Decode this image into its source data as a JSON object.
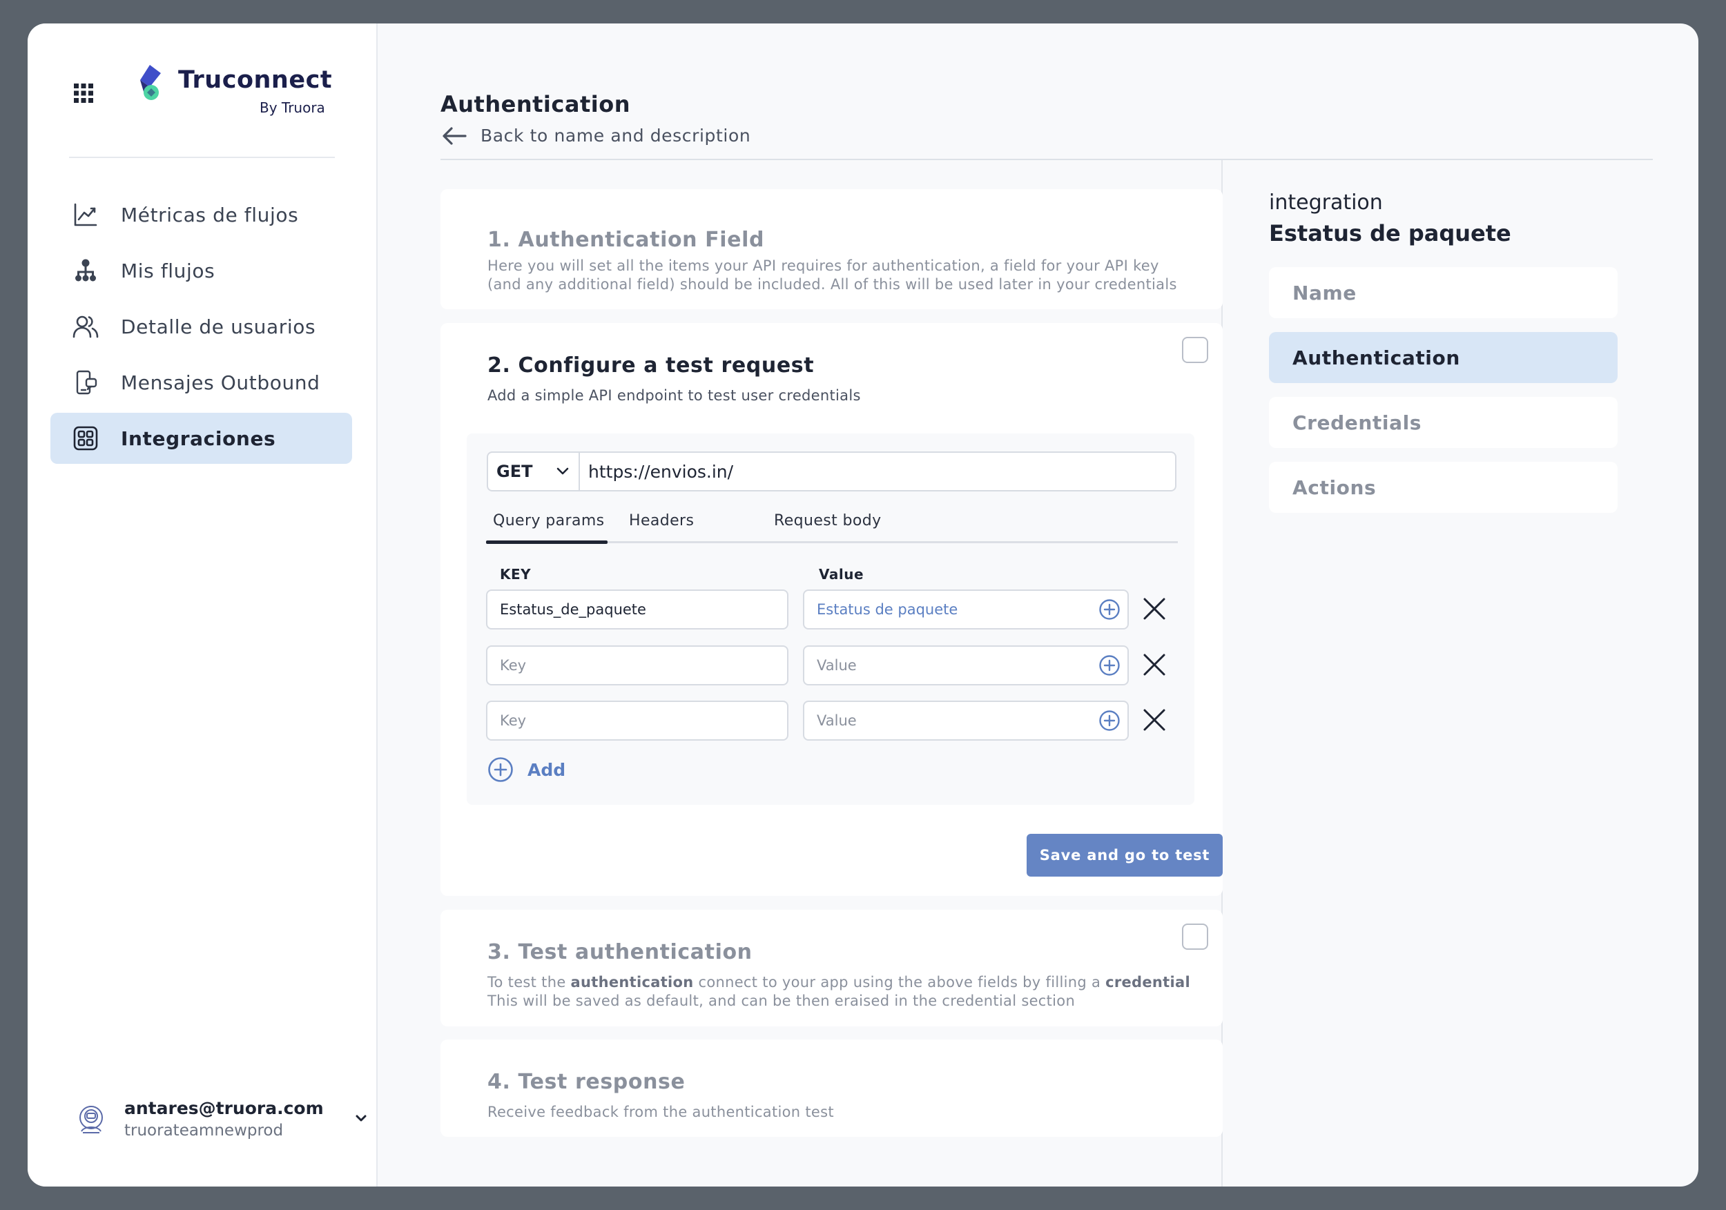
{
  "app": {
    "brand_name": "Truconnect",
    "brand_sub": "By Truora",
    "accent_color": "#6585c4",
    "active_bg_color": "#d8e6f6"
  },
  "sidebar": {
    "items": [
      {
        "label": "Métricas de flujos",
        "icon": "chart-icon"
      },
      {
        "label": "Mis flujos",
        "icon": "flow-icon"
      },
      {
        "label": "Detalle de usuarios",
        "icon": "users-icon"
      },
      {
        "label": "Mensajes Outbound",
        "icon": "message-icon"
      },
      {
        "label": "Integraciones",
        "icon": "integrations-icon",
        "active": true
      }
    ],
    "user": {
      "email": "antares@truora.com",
      "team": "truorateamnewprod"
    }
  },
  "header": {
    "title": "Authentication",
    "back_label": "Back to name and description"
  },
  "steps": {
    "step1": {
      "title": "1. Authentication Field",
      "desc_line1": "Here you will set all the items your API requires for authentication, a field for your API key",
      "desc_line2": "(and any additional field) should be included. All of this will be used later in your credentials"
    },
    "step2": {
      "title": "2. Configure a test request",
      "desc": "Add a simple API endpoint to test user credentials",
      "method": "GET",
      "url": "https://envios.in/",
      "tabs": [
        "Query params",
        "Headers",
        "Request body"
      ],
      "active_tab": "Query params",
      "key_header": "KEY",
      "value_header": "Value",
      "rows": [
        {
          "key": "Estatus_de_paquete",
          "value": "Estatus de paquete"
        },
        {
          "key": "",
          "value": ""
        },
        {
          "key": "",
          "value": ""
        }
      ],
      "key_placeholder": "Key",
      "value_placeholder": "Value",
      "add_label": "Add",
      "save_label": "Save and go to test"
    },
    "step3": {
      "title": "3. Test authentication",
      "desc_pre": "To test the ",
      "desc_bold1": "authentication",
      "desc_mid": " connect to your app using the above fields by filling a ",
      "desc_bold2": "credential",
      "desc_line2": "This will be saved as default, and can be then eraised in the credential section"
    },
    "step4": {
      "title": "4. Test response",
      "desc": "Receive feedback from the authentication test"
    }
  },
  "right_panel": {
    "label": "integration",
    "name": "Estatus de paquete",
    "steps": [
      "Name",
      "Authentication",
      "Credentials",
      "Actions"
    ],
    "active_step": "Authentication"
  }
}
